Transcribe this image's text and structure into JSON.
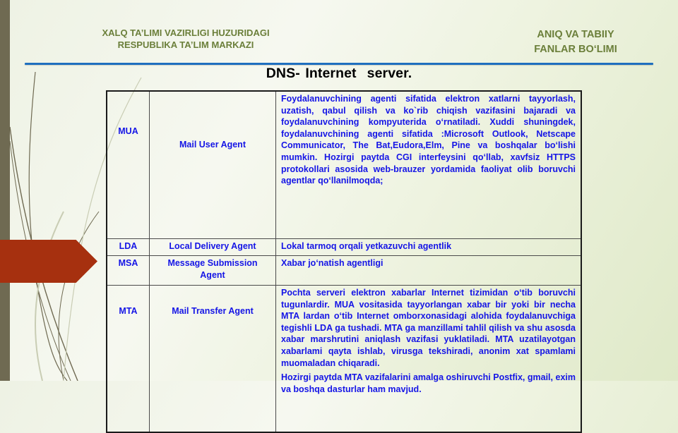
{
  "header": {
    "left_line1": "XALQ TA’LIMI VAZIRLIGI HUZURIDAGI",
    "left_line2": "RESPUBLIKA TA’LIM MARKAZI",
    "right_line1": "ANIQ VA TABIIY",
    "right_line2": "FANLAR BO‘LIMI"
  },
  "title": "DNS- Internet  server.",
  "colors": {
    "header_text": "#6b7f3a",
    "rule": "#1f6fbf",
    "table_text": "#1515e6",
    "arrow": "#a6300f",
    "left_bar": "#6f6a52"
  },
  "table": {
    "rows": [
      {
        "abbr": "MUA",
        "name": "Mail User Agent",
        "description": [
          "Foydalanuvchining agenti sifatida elektron xatlarni tayyorlash, uzatish, qabul qilish va ko`rib chiqish vazifasini bajaradi va foydalanuvchining kompyuterida o‘rnatiladi. Xuddi shuningdek, foydalanuvchining  agenti sifatida :Microsoft Outlook, Netscape Communicator, The Bat,Eudora,Elm, Pine va boshqalar bo‘lishi  mumkin. Hozirgi paytda CGI interfeysini qo‘llab, xavfsiz HTTPS protokollari asosida web-brauzer yordamida faoliyat olib boruvchi agentlar qo‘llanilmoqda;"
        ]
      },
      {
        "abbr": "LDA",
        "name": "Local Delivery Agent",
        "description": [
          "Lokal tarmoq orqali yetkazuvchi agentlik"
        ]
      },
      {
        "abbr": "MSA",
        "name": "Message Submission Agent",
        "description": [
          "Xabar jo‘natish agentligi"
        ]
      },
      {
        "abbr": "MTA",
        "name": "Mail Transfer Agent",
        "description": [
          "Pochta serveri elektron xabarlar Internet tizimidan o‘tib boruvchi  tugunlardir.  MUA vositasida tayyorlangan xabar  bir yoki  bir necha MTA  lardan o‘tib  Internet omborxonasidagi alohida  foydalanuvchiga tegishli LDA ga tushadi. MTA ga manzillami tahlil qilish va shu asosda xabar marshrutini aniqlash vazifasi yuklatiladi. MTA uzatilayotgan xabarlami qayta ishlab, virusga tekshiradi, anonim xat spamlami muomaladan chiqaradi.",
          "Hozirgi paytda MTA vazifalarini amalga oshiruvchi Postfix, gmail, exim va boshqa dasturlar ham mavjud."
        ]
      }
    ]
  }
}
